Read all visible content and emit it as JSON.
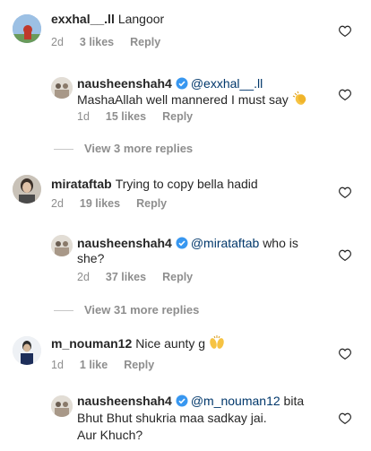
{
  "comments": [
    {
      "username": "exxhal__.ll",
      "text": "Langoor",
      "time": "2d",
      "likes": "3 likes",
      "reply": "Reply"
    },
    {
      "username": "nausheenshah4",
      "mention": "@exxhal__.ll",
      "text": "MashaAllah well mannered I must say",
      "emoji": "clapping-hands",
      "time": "1d",
      "likes": "15 likes",
      "reply": "Reply"
    },
    {
      "username": "mirataftab",
      "text": "Trying to copy bella hadid",
      "time": "2d",
      "likes": "19 likes",
      "reply": "Reply"
    },
    {
      "username": "nausheenshah4",
      "mention": "@mirataftab",
      "text_line1": "who is",
      "text_line2": "she?",
      "time": "2d",
      "likes": "37 likes",
      "reply": "Reply"
    },
    {
      "username": "m_nouman12",
      "text": "Nice aunty g",
      "emoji": "raising-hands",
      "time": "1d",
      "likes": "1 like",
      "reply": "Reply"
    },
    {
      "username": "nausheenshah4",
      "mention": "@m_nouman12",
      "text_line1": "bita",
      "text_line2": "Bhut Bhut shukria maa sadkay jai.",
      "text_line3": "Aur Khuch?"
    }
  ],
  "view_more": [
    "View 3 more replies",
    "View 31 more replies"
  ],
  "colors": {
    "text": "#262626",
    "secondary": "#8e8e8e",
    "mention": "#00376b",
    "verified": "#3897f0"
  }
}
